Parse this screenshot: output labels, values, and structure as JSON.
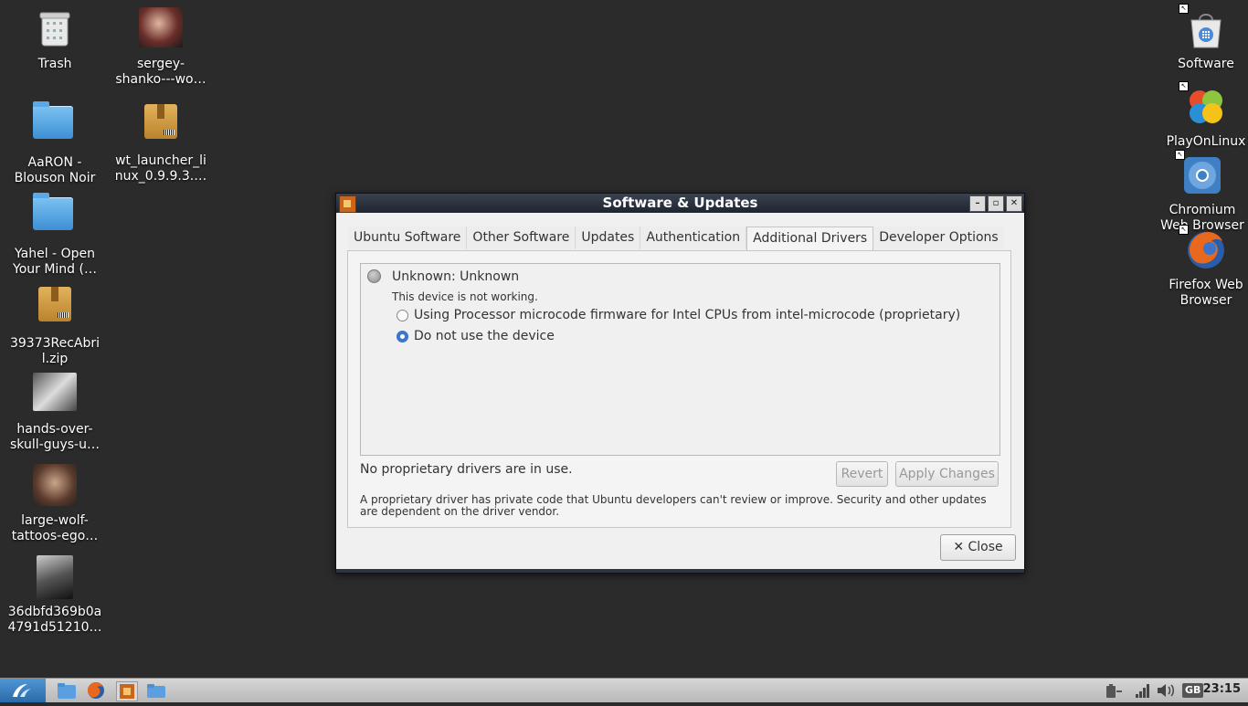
{
  "desktop": {
    "icons_left_col1": [
      {
        "label": "Trash",
        "icon": "trash-icon"
      },
      {
        "label": "AaRON -\nBlouson Noir",
        "icon": "folder-icon"
      },
      {
        "label": "Yahel - Open\nYour Mind (…",
        "icon": "folder-icon"
      },
      {
        "label": "39373RecAbri\nl.zip",
        "icon": "package-icon"
      },
      {
        "label": "hands-over-\nskull-guys-u…",
        "icon": "image-icon"
      },
      {
        "label": "large-wolf-\ntattoos-ego…",
        "icon": "image-icon"
      },
      {
        "label": "36dbfd369b0a\n4791d51210…",
        "icon": "image-icon"
      }
    ],
    "icons_left_col2": [
      {
        "label": "sergey-\nshanko---wo…",
        "icon": "image-icon"
      },
      {
        "label": "wt_launcher_li\nnux_0.9.9.3.…",
        "icon": "package-icon"
      }
    ],
    "icons_right": [
      {
        "label": "Software",
        "icon": "software-center-icon"
      },
      {
        "label": "PlayOnLinux",
        "icon": "playonlinux-icon"
      },
      {
        "label": "Chromium\nWeb Browser",
        "icon": "chromium-icon"
      },
      {
        "label": "Firefox Web\nBrowser",
        "icon": "firefox-icon"
      }
    ]
  },
  "window": {
    "title": "Software & Updates",
    "tabs": [
      "Ubuntu Software",
      "Other Software",
      "Updates",
      "Authentication",
      "Additional Drivers",
      "Developer Options"
    ],
    "active_tab": "Additional Drivers",
    "device": {
      "name": "Unknown: Unknown",
      "status": "This device is not working.",
      "options": [
        {
          "label": "Using Processor microcode firmware for Intel CPUs from intel-microcode (proprietary)",
          "selected": false
        },
        {
          "label": "Do not use the device",
          "selected": true
        }
      ]
    },
    "status_text": "No proprietary drivers are in use.",
    "revert_label": "Revert",
    "apply_label": "Apply Changes",
    "note": "A proprietary driver has private code that Ubuntu developers can't review or improve. Security and other updates are dependent on the driver vendor.",
    "close_label": "Close"
  },
  "taskbar": {
    "clock": "23:15",
    "keyboard_layout": "GB"
  }
}
